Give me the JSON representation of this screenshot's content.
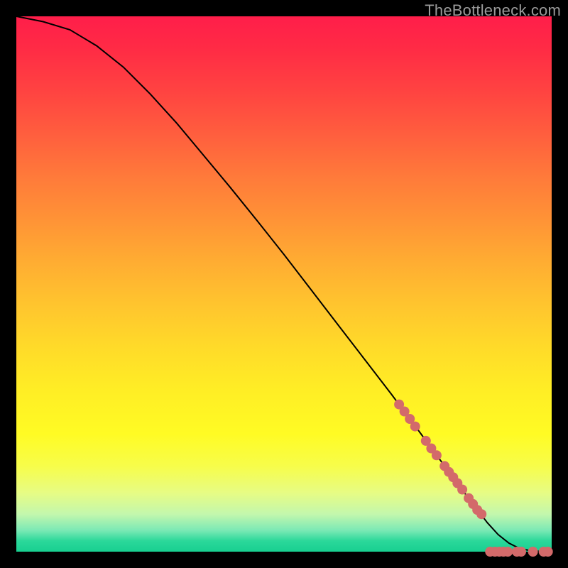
{
  "brand": {
    "watermark": "TheBottleneck.com"
  },
  "colors": {
    "dot": "#d36a6a",
    "curve": "#000000",
    "frame": "#000000",
    "gradient_top": "#ff1e4a",
    "gradient_bottom": "#18cf90"
  },
  "chart_data": {
    "type": "line",
    "title": "",
    "xlabel": "",
    "ylabel": "",
    "xlim": [
      0,
      100
    ],
    "ylim": [
      0,
      100
    ],
    "grid": false,
    "legend": false,
    "series": [
      {
        "name": "curve",
        "kind": "line",
        "x": [
          0,
          5,
          10,
          15,
          20,
          25,
          30,
          35,
          40,
          45,
          50,
          55,
          60,
          65,
          70,
          75,
          80,
          82,
          84,
          86,
          88,
          90,
          92,
          94,
          96,
          98,
          100
        ],
        "y": [
          100,
          99,
          97.5,
          94.5,
          90.5,
          85.5,
          80,
          74,
          68,
          61.8,
          55.5,
          49,
          42.5,
          36,
          29.5,
          22.8,
          16,
          13.3,
          10.6,
          8,
          5.4,
          3.2,
          1.6,
          0.6,
          0.2,
          0.05,
          0
        ]
      },
      {
        "name": "points-on-curve",
        "kind": "scatter",
        "x": [
          71.5,
          72.5,
          73.5,
          74.5,
          76.5,
          77.5,
          78.5,
          80.0,
          80.8,
          81.6,
          82.4,
          83.3,
          84.5,
          85.3,
          86.1,
          86.9
        ],
        "y": [
          27.5,
          26.2,
          24.8,
          23.4,
          20.7,
          19.3,
          18.0,
          16.0,
          14.9,
          13.9,
          12.8,
          11.6,
          10.0,
          8.9,
          7.8,
          7.0
        ]
      },
      {
        "name": "points-on-floor",
        "kind": "scatter",
        "x": [
          88.5,
          89.4,
          90.2,
          91.0,
          91.8,
          93.5,
          94.3,
          96.5,
          98.5,
          99.3
        ],
        "y": [
          0,
          0,
          0,
          0,
          0,
          0,
          0,
          0,
          0,
          0
        ]
      }
    ]
  }
}
